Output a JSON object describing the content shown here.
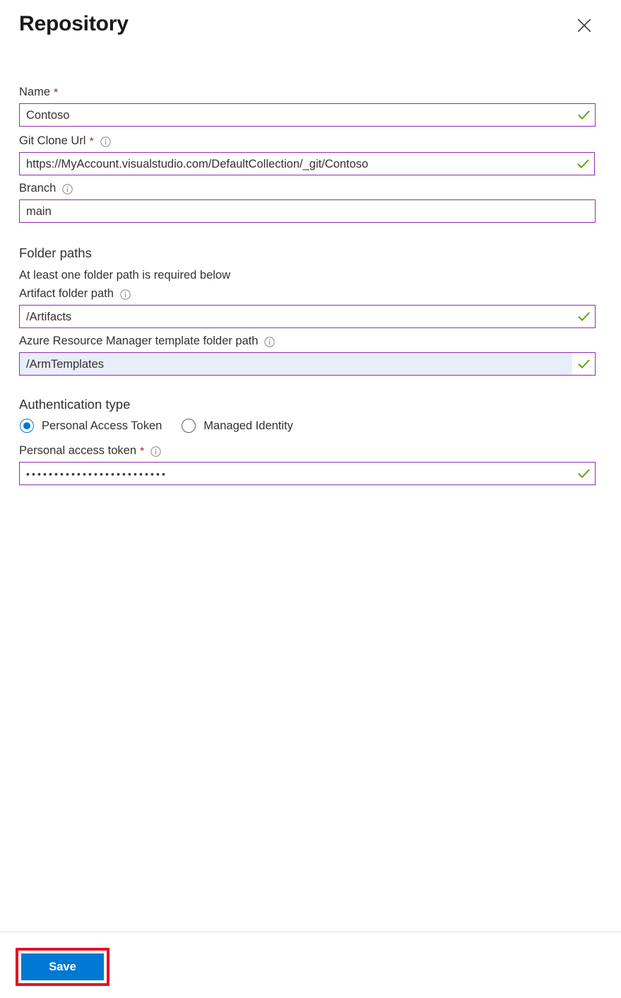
{
  "header": {
    "title": "Repository",
    "close_label": "Close",
    "close_icon": "close-icon"
  },
  "fields": {
    "name": {
      "label": "Name",
      "required": true,
      "has_info": false,
      "value": "Contoso",
      "valid": true
    },
    "git_clone_url": {
      "label": "Git Clone Url",
      "required": true,
      "has_info": true,
      "value": "https://MyAccount.visualstudio.com/DefaultCollection/_git/Contoso",
      "valid": true
    },
    "branch": {
      "label": "Branch",
      "required": false,
      "has_info": true,
      "value": "main",
      "valid": false
    }
  },
  "folder_paths": {
    "heading": "Folder paths",
    "subtitle": "At least one folder path is required below",
    "artifact": {
      "label": "Artifact folder path",
      "required": false,
      "has_info": true,
      "value": "/Artifacts",
      "valid": true
    },
    "arm_template": {
      "label": "Azure Resource Manager template folder path",
      "required": false,
      "has_info": true,
      "value": "/ArmTemplates",
      "valid": true,
      "selected": true
    }
  },
  "authentication": {
    "heading": "Authentication type",
    "options": [
      {
        "label": "Personal Access Token",
        "checked": true
      },
      {
        "label": "Managed Identity",
        "checked": false
      }
    ],
    "token": {
      "label": "Personal access token",
      "required": true,
      "has_info": true,
      "value": "•••••••••••••••••••••••••",
      "valid": true
    }
  },
  "footer": {
    "save_label": "Save"
  },
  "colors": {
    "accent_blue": "#0078d4",
    "field_border_purple": "#8b2fb0",
    "valid_check_green": "#57a300",
    "required_star_red": "#a4262c",
    "annotation_red": "#e81123",
    "selected_field_bg": "#e8edfa",
    "divider": "#e1dfdd"
  }
}
